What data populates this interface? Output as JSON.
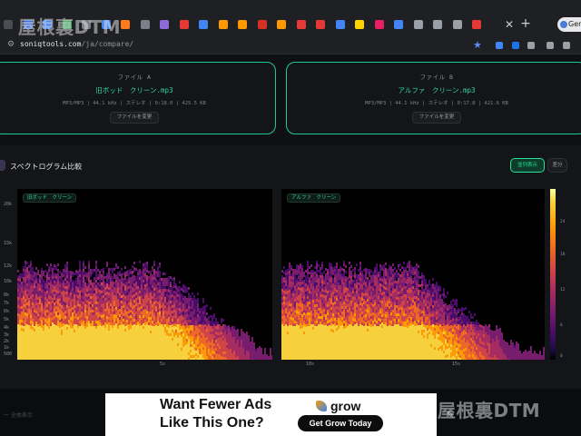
{
  "browser": {
    "url_domain": "soniqtools.com",
    "url_path": "/ja/compare/",
    "tab_pill_label": "Ger",
    "tab_colors": [
      "#4a4d52",
      "#3c6fd8",
      "#4285f4",
      "#34a853",
      "#7b8088",
      "#4285f4",
      "#ff7a1a",
      "#7b8088",
      "#8c6bd8",
      "#e53935",
      "#4285f4",
      "#ff9800",
      "#ff9800",
      "#d93025",
      "#ff9800",
      "#e53935",
      "#e53935",
      "#4285f4",
      "#ffd400",
      "#e91e63",
      "#4285f4",
      "#9aa0a6",
      "#9aa0a6",
      "#9aa0a6",
      "#e53935"
    ]
  },
  "fileA": {
    "title": "ファイル A",
    "name": "旧ボッド　クリーン.mp3",
    "meta": "MP3/MP3 | 44.1 kHz | ステレオ | 0:18.0 | 425.5 KB",
    "button": "ファイルを変更"
  },
  "fileB": {
    "title": "ファイル B",
    "name": "アルファ　クリーン.mp3",
    "meta": "MP3/MP3 | 44.1 kHz | ステレオ | 0:17.8 | 421.6 KB",
    "button": "ファイルを変更"
  },
  "spectrogram": {
    "title": "スペクトログラム比較",
    "toggle_on": "並列表示",
    "toggle_off": "差分",
    "label_a": "旧ボッド　クリーン",
    "label_b": "アルファ　クリーン",
    "y_ticks": [
      "20k",
      "15k",
      "12k",
      "10k",
      "8k",
      "7k",
      "6k",
      "5k",
      "4k",
      "3k",
      "2k",
      "1k",
      "500"
    ],
    "x_ticks": [
      "5s",
      "10s",
      "15s"
    ],
    "colorbar_ticks": [
      "24",
      "18",
      "12",
      "6",
      "0"
    ]
  },
  "ad": {
    "line1": "Want Fewer Ads",
    "line2": "Like This One?",
    "brand": "grow",
    "cta": "Get Grow Today"
  },
  "bottom": {
    "text": "ー 全体表示"
  },
  "watermark": "屋根裏DTM"
}
